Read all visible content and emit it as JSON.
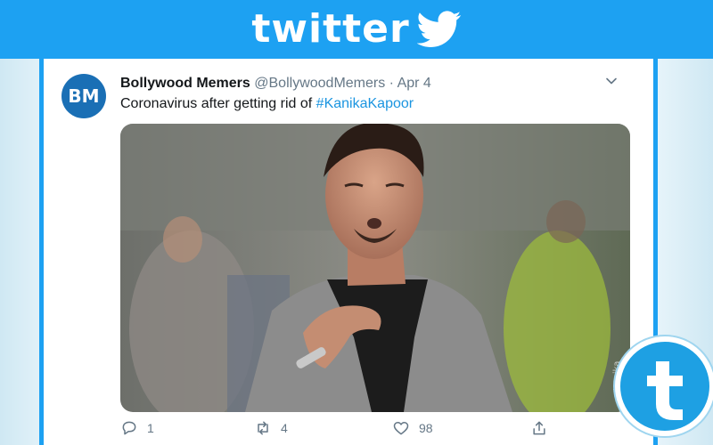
{
  "banner": {
    "wordmark": "twitter"
  },
  "tweet": {
    "avatar_initials": "BM",
    "display_name": "Bollywood Memers",
    "handle": "@BollywoodMemers",
    "separator": "·",
    "date": "Apr 4",
    "text": "Coronavirus after getting rid of ",
    "hashtag": "#KanikaKapoor",
    "actions": {
      "reply_count": "1",
      "retweet_count": "4",
      "like_count": "98"
    }
  },
  "colors": {
    "twitter_blue": "#1da1f2",
    "hashtag_blue": "#1b95e0",
    "avatar_blue": "#1a6fb5"
  },
  "icons": [
    "twitter-bird-icon",
    "chevron-down-icon",
    "reply-icon",
    "retweet-icon",
    "like-icon",
    "share-icon",
    "t-logo-icon"
  ]
}
